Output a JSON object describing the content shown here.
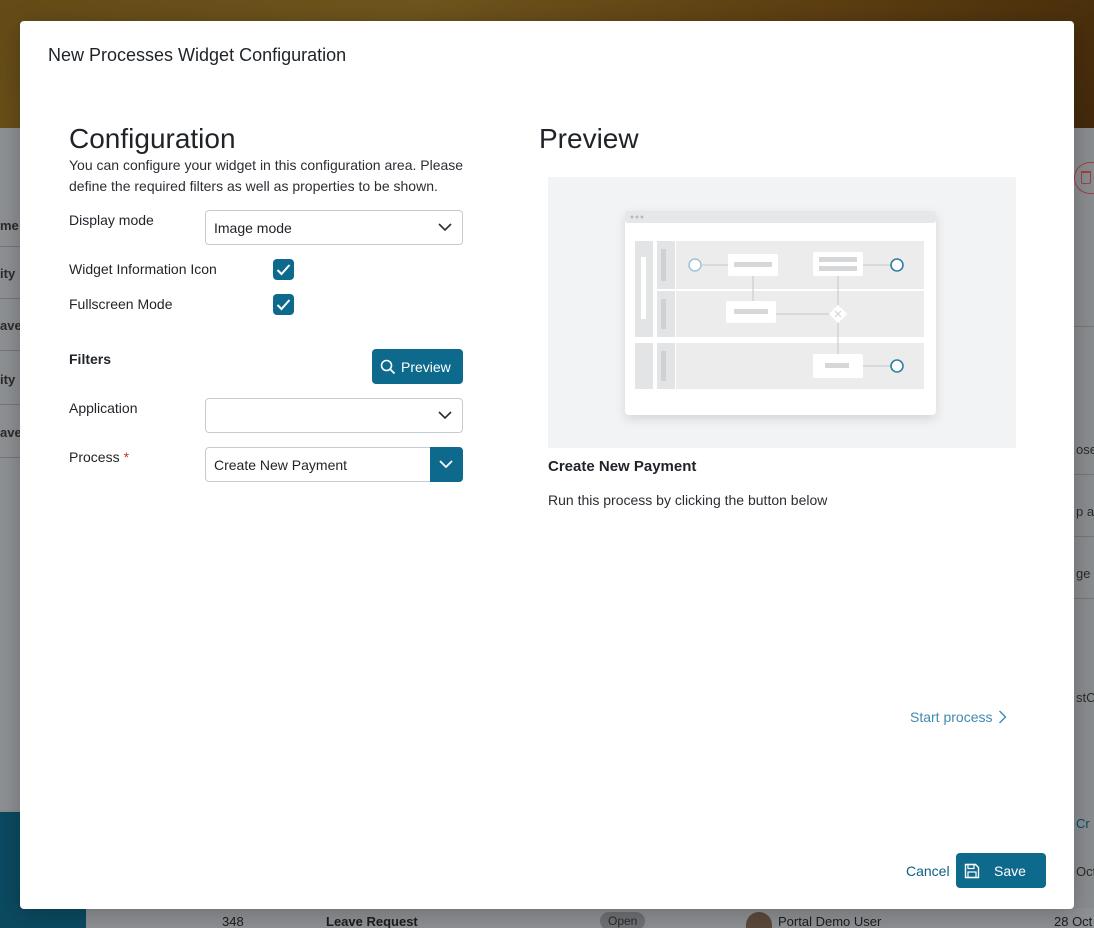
{
  "background": {
    "left_fragments": [
      "me",
      "ity",
      "ave",
      "ity",
      "ave"
    ],
    "right_fragments": [
      "ose",
      "p al",
      "ge",
      "stCa",
      "Cr",
      "Oct"
    ],
    "bottom_row": {
      "id": "348",
      "title": "Leave Request",
      "status": "Open",
      "user": "Portal Demo User",
      "date": "28 Oct"
    }
  },
  "modal": {
    "title": "New Processes Widget Configuration"
  },
  "configuration": {
    "heading": "Configuration",
    "description": "You can configure your widget in this configuration area. Please define the required filters as well as properties to be shown.",
    "display_mode": {
      "label": "Display mode",
      "value": "Image mode"
    },
    "widget_info_icon": {
      "label": "Widget Information Icon",
      "checked": true
    },
    "fullscreen_mode": {
      "label": "Fullscreen Mode",
      "checked": true
    },
    "filters_label": "Filters",
    "preview_button": "Preview",
    "application": {
      "label": "Application",
      "value": ""
    },
    "process": {
      "label": "Process",
      "required_mark": "*",
      "value": "Create New Payment"
    }
  },
  "preview": {
    "heading": "Preview",
    "process_title": "Create New Payment",
    "process_description": "Run this process by clicking the button below",
    "start_link": "Start process"
  },
  "footer": {
    "cancel": "Cancel",
    "save": "Save"
  },
  "colors": {
    "primary": "#0e6a8c",
    "link": "#3d8bb0",
    "required": "#c0392b"
  }
}
